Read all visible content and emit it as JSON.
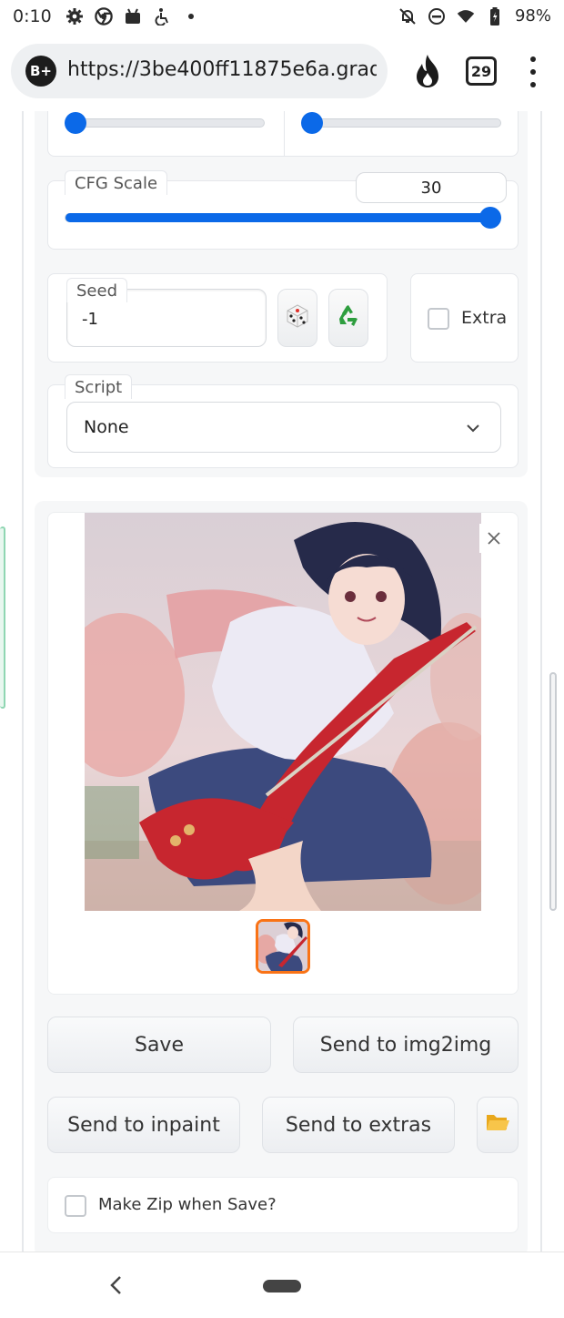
{
  "status_bar": {
    "time": "0:10",
    "battery": "98%",
    "icons_left": [
      "settings-icon",
      "chrome-icon",
      "android-debug-icon",
      "accessibility-icon",
      "notification-dot-icon"
    ],
    "icons_right": [
      "mute-icon",
      "dnd-icon",
      "wifi-icon",
      "battery-icon"
    ]
  },
  "browser": {
    "badge": "B+",
    "url": "https://3be400ff11875e6a.grad",
    "tab_count": "29",
    "icons": [
      "fire-icon",
      "tabs-icon",
      "overflow-menu-icon"
    ]
  },
  "controls": {
    "sliders_top": [
      {
        "name": "left-slider",
        "value_fraction": 0.0
      },
      {
        "name": "right-slider",
        "value_fraction": 0.0
      }
    ],
    "cfg_scale": {
      "label": "CFG Scale",
      "value": "30",
      "value_fraction": 1.0
    },
    "seed": {
      "label": "Seed",
      "value": "-1",
      "random_icon": "dice-icon",
      "reuse_icon": "recycle-icon"
    },
    "extra": {
      "label": "Extra",
      "checked": false
    },
    "script": {
      "label": "Script",
      "selected": "None"
    }
  },
  "gallery": {
    "close_icon": "close-icon",
    "thumbnail_count": 1
  },
  "actions": {
    "save": "Save",
    "send_img2img": "Send to img2img",
    "send_inpaint": "Send to inpaint",
    "send_extras": "Send to extras",
    "folder_icon": "folder-icon",
    "make_zip_label": "Make Zip when Save?",
    "make_zip_checked": false
  },
  "colors": {
    "accent": "#0b69e8",
    "thumb_border": "#f97316"
  }
}
